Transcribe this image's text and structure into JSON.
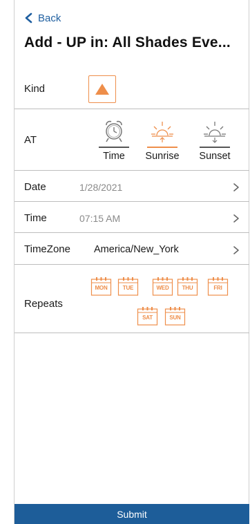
{
  "nav": {
    "back_label": "Back"
  },
  "header": {
    "title": "Add - UP in: All Shades Eve..."
  },
  "kind": {
    "label": "Kind",
    "icon": "triangle-up-icon",
    "accent": "#ee8e4a"
  },
  "at": {
    "label": "AT",
    "options": [
      {
        "label": "Time",
        "icon": "alarm-clock-icon",
        "selected": false
      },
      {
        "label": "Sunrise",
        "icon": "sunrise-icon",
        "selected": true
      },
      {
        "label": "Sunset",
        "icon": "sunset-icon",
        "selected": false
      }
    ]
  },
  "date": {
    "label": "Date",
    "value": "1/28/2021"
  },
  "time": {
    "label": "Time",
    "value": "07:15 AM"
  },
  "timezone": {
    "label": "TimeZone",
    "value": "America/New_York"
  },
  "repeats": {
    "label": "Repeats",
    "days": [
      "MON",
      "TUE",
      "WED",
      "THU",
      "FRI",
      "SAT",
      "SUN"
    ]
  },
  "footer": {
    "submit_label": "Submit"
  },
  "colors": {
    "accent": "#ee8e4a",
    "link": "#1f5fa0",
    "submit_bg": "#1d5d99"
  }
}
